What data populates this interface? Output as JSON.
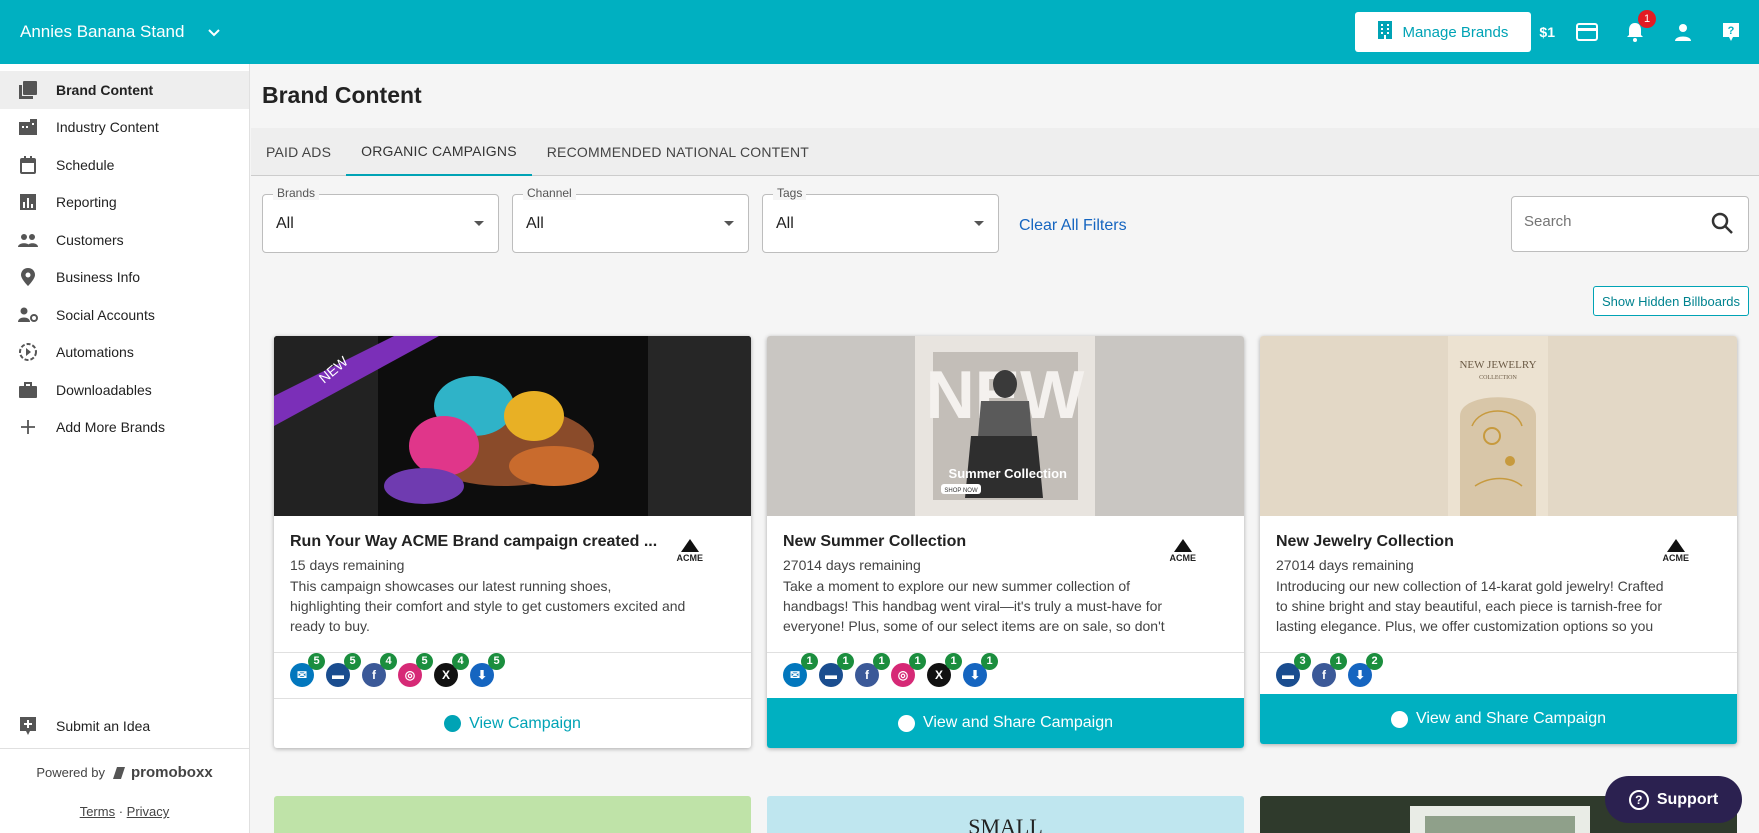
{
  "topbar": {
    "account_name": "Annies Banana Stand",
    "manage_brands_label": "Manage Brands",
    "credit": "$1",
    "notifications_count": "1",
    "brand_color": "#00b0c1"
  },
  "sidebar": {
    "items": [
      {
        "label": "Brand Content",
        "icon": "brand-content-icon"
      },
      {
        "label": "Industry Content",
        "icon": "building-icon"
      },
      {
        "label": "Schedule",
        "icon": "calendar-icon"
      },
      {
        "label": "Reporting",
        "icon": "bar-chart-icon"
      },
      {
        "label": "Customers",
        "icon": "people-icon"
      },
      {
        "label": "Business Info",
        "icon": "location-pin-icon"
      },
      {
        "label": "Social Accounts",
        "icon": "person-gear-icon"
      },
      {
        "label": "Automations",
        "icon": "automation-icon"
      },
      {
        "label": "Downloadables",
        "icon": "briefcase-icon"
      },
      {
        "label": "Add More Brands",
        "icon": "plus-icon"
      }
    ],
    "submit_idea": "Submit an Idea",
    "powered_by": "Powered by",
    "brand_logo": "promoboxx",
    "terms": "Terms",
    "separator": "·",
    "privacy": "Privacy"
  },
  "main": {
    "title": "Brand Content",
    "tabs": [
      "PAID ADS",
      "ORGANIC CAMPAIGNS",
      "RECOMMENDED NATIONAL CONTENT"
    ],
    "active_tab": "ORGANIC CAMPAIGNS",
    "filters": [
      {
        "label": "Brands",
        "value": "All"
      },
      {
        "label": "Channel",
        "value": "All"
      },
      {
        "label": "Tags",
        "value": "All"
      }
    ],
    "clear_filters": "Clear All Filters",
    "search_placeholder": "Search",
    "show_hidden": "Show Hidden Billboards"
  },
  "cards": [
    {
      "title": "Run Your Way ACME Brand campaign created ...",
      "days": "15 days remaining",
      "description": "This campaign showcases our latest running shoes, highlighting their comfort and style to get customers excited and ready to buy.",
      "ribbon": "NEW",
      "brand": "ACME",
      "channels": [
        {
          "type": "email",
          "count": "5"
        },
        {
          "type": "billboard",
          "count": "5"
        },
        {
          "type": "facebook",
          "count": "4"
        },
        {
          "type": "instagram",
          "count": "5"
        },
        {
          "type": "x",
          "count": "4"
        },
        {
          "type": "download",
          "count": "5"
        }
      ],
      "cta": "View Campaign"
    },
    {
      "title": "New Summer Collection",
      "days": "27014 days remaining",
      "description": "Take a moment to explore our new summer collection of handbags! This handbag went viral—it's truly a must-have for everyone! Plus, some of our select items are on sale, so don't miss out! #SummerCollection #Sal...",
      "image_text": "NEW",
      "image_caption": "Summer Collection",
      "image_button": "SHOP NOW",
      "brand": "ACME",
      "channels": [
        {
          "type": "email",
          "count": "1"
        },
        {
          "type": "billboard",
          "count": "1"
        },
        {
          "type": "facebook",
          "count": "1"
        },
        {
          "type": "instagram",
          "count": "1"
        },
        {
          "type": "x",
          "count": "1"
        },
        {
          "type": "download",
          "count": "1"
        }
      ],
      "cta": "View and Share Campaign"
    },
    {
      "title": "New Jewelry Collection",
      "days": "27014 days remaining",
      "description": "Introducing our new collection of 14-karat gold jewelry! Crafted to shine bright and stay beautiful, each piece is tarnish-free for lasting elegance. Plus, we offer customization options so you can create something truly...",
      "image_text": "NEW JEWELRY",
      "image_sub": "COLLECTION",
      "brand": "ACME",
      "channels": [
        {
          "type": "billboard",
          "count": "3"
        },
        {
          "type": "facebook",
          "count": "1"
        },
        {
          "type": "download",
          "count": "2"
        }
      ],
      "cta": "View and Share Campaign"
    }
  ],
  "row2": {
    "card2_text": "SMALL"
  },
  "support": {
    "label": "Support"
  }
}
